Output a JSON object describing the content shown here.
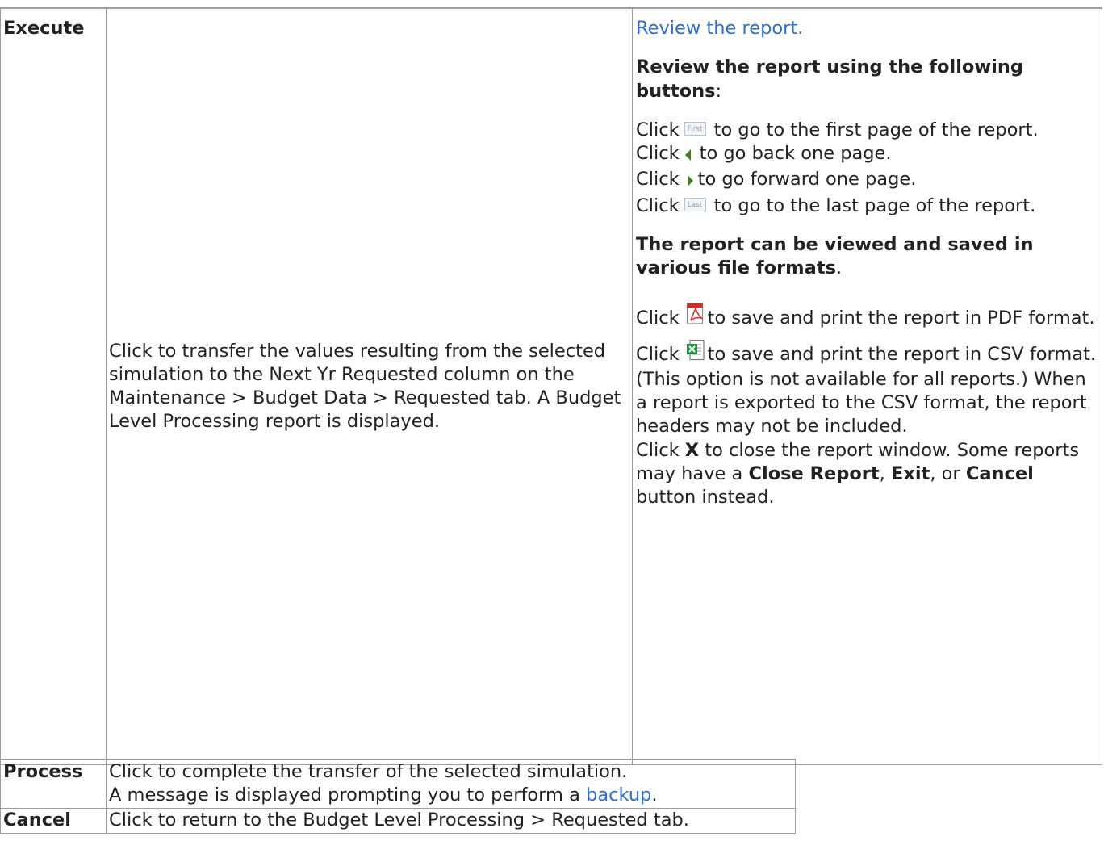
{
  "execute": {
    "label": "Execute",
    "description": "Click to transfer the values resulting from the selected simulation to the Next Yr Requested column on the Maintenance > Budget Data > Requested tab. A Budget Level Processing report is displayed.",
    "review_link": "Review the report.",
    "review_heading": "Review the report using the following buttons",
    "review_heading_suffix": ":",
    "nav_lines": {
      "first": {
        "pre": "Click",
        "icon": "first-page-button-icon",
        "icon_text": "First",
        "post": "to go to the first page of the report."
      },
      "prev": {
        "pre": "Click",
        "icon": "previous-page-triangle-icon",
        "post": "to go back one page."
      },
      "next": {
        "pre": "Click",
        "icon": "next-page-triangle-icon",
        "post": "to go forward one page."
      },
      "last": {
        "pre": "Click",
        "icon": "last-page-button-icon",
        "icon_text": "Last",
        "post": "to go to the last page of the report."
      }
    },
    "formats_heading": "The report can be viewed and saved in various file formats",
    "formats_heading_suffix": ".",
    "pdf_line": {
      "pre": "Click",
      "icon": "pdf-file-icon",
      "post": "to save and print the report in PDF format."
    },
    "csv_line": {
      "pre": "Click",
      "icon": "excel-csv-file-icon",
      "post": "to save and print the report in CSV format. (This option is not available for all reports.) When a report is exported to the CSV format, the report headers may not be included."
    },
    "close_line": {
      "t1": "Click",
      "b1": "X",
      "t2": "to close the report window. Some reports may have a",
      "b2": "Close Report",
      "t3": ",",
      "b3": "Exit",
      "t4": ", or",
      "b4": "Cancel",
      "t5": "button instead."
    }
  },
  "process": {
    "label": "Process",
    "line1": "Click to complete the transfer of the selected simulation.",
    "line2_pre": "A message is displayed prompting you to perform a",
    "line2_link": "backup",
    "line2_post": "."
  },
  "cancel": {
    "label": "Cancel",
    "description": "Click to return to the Budget Level Processing > Requested tab."
  },
  "colors": {
    "link": "#2b6fd6",
    "border": "#9e9e9e",
    "text": "#222222"
  }
}
